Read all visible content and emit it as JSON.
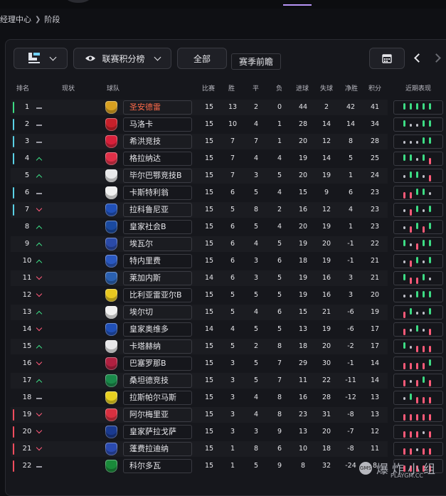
{
  "breadcrumb": {
    "parent": "经理中心",
    "current": "阶段"
  },
  "controls": {
    "league_view": "联赛积分榜",
    "scope": "全部",
    "season_tab": "赛季前瞻"
  },
  "headers": {
    "rank": "排名",
    "trend": "现状",
    "team": "球队",
    "played": "比赛",
    "won": "胜",
    "drawn": "平",
    "lost": "负",
    "gf": "进球",
    "ga": "失球",
    "gd": "净胜",
    "pts": "积分",
    "form": "近期表现"
  },
  "colors": {
    "champions": "#3ddc84",
    "europa": "#5ad1e6",
    "relegation": "#ff4d5e",
    "win": "#3ddc84",
    "draw": "#bfc0c8",
    "loss": "#ff5a78",
    "highlight_team": "#ff6b4a"
  },
  "rows": [
    {
      "pos": "1",
      "trend": "same",
      "team": "圣安德雷",
      "p": "15",
      "w": "13",
      "d": "2",
      "l": "0",
      "gf": "44",
      "ga": "2",
      "gd": "42",
      "pts": "41",
      "zone": "champions",
      "hl": true,
      "form": [
        "w",
        "w",
        "w",
        "w",
        "w"
      ],
      "crest": "#d8a020"
    },
    {
      "pos": "2",
      "trend": "same",
      "team": "马洛卡",
      "p": "15",
      "w": "10",
      "d": "4",
      "l": "1",
      "gf": "28",
      "ga": "14",
      "gd": "14",
      "pts": "34",
      "zone": "europa",
      "form": [
        "w",
        "d",
        "d",
        "w",
        "w"
      ],
      "crest": "#c8202a"
    },
    {
      "pos": "3",
      "trend": "same",
      "team": "希洪竞技",
      "p": "15",
      "w": "7",
      "d": "7",
      "l": "1",
      "gf": "20",
      "ga": "12",
      "gd": "8",
      "pts": "28",
      "zone": "europa",
      "form": [
        "d",
        "d",
        "d",
        "w",
        "w"
      ],
      "crest": "#d8203a"
    },
    {
      "pos": "4",
      "trend": "up",
      "team": "格拉纳达",
      "p": "15",
      "w": "7",
      "d": "4",
      "l": "4",
      "gf": "19",
      "ga": "14",
      "gd": "5",
      "pts": "25",
      "zone": "europa",
      "form": [
        "w",
        "w",
        "d",
        "w",
        "l"
      ],
      "crest": "#e03048"
    },
    {
      "pos": "5",
      "trend": "up",
      "team": "毕尔巴鄂竞技B",
      "p": "15",
      "w": "7",
      "d": "3",
      "l": "5",
      "gf": "20",
      "ga": "19",
      "gd": "1",
      "pts": "24",
      "zone": "",
      "form": [
        "d",
        "w",
        "w",
        "d",
        "l"
      ],
      "crest": "#e8e8ea"
    },
    {
      "pos": "6",
      "trend": "same",
      "team": "卡斯特利翁",
      "p": "15",
      "w": "6",
      "d": "5",
      "l": "4",
      "gf": "15",
      "ga": "9",
      "gd": "6",
      "pts": "23",
      "zone": "europa",
      "form": [
        "l",
        "l",
        "w",
        "w",
        "d"
      ],
      "crest": "#f0f0f0"
    },
    {
      "pos": "7",
      "trend": "down",
      "team": "拉科鲁尼亚",
      "p": "15",
      "w": "5",
      "d": "8",
      "l": "2",
      "gf": "16",
      "ga": "12",
      "gd": "4",
      "pts": "23",
      "zone": "europa",
      "form": [
        "d",
        "l",
        "w",
        "d",
        "w"
      ],
      "crest": "#2050b8"
    },
    {
      "pos": "8",
      "trend": "up",
      "team": "皇家社会B",
      "p": "15",
      "w": "6",
      "d": "5",
      "l": "4",
      "gf": "20",
      "ga": "19",
      "gd": "1",
      "pts": "23",
      "zone": "",
      "form": [
        "d",
        "l",
        "w",
        "l",
        "w"
      ],
      "crest": "#1a4aa0"
    },
    {
      "pos": "9",
      "trend": "up",
      "team": "埃瓦尔",
      "p": "15",
      "w": "6",
      "d": "4",
      "l": "5",
      "gf": "19",
      "ga": "20",
      "gd": "-1",
      "pts": "22",
      "zone": "",
      "form": [
        "w",
        "d",
        "l",
        "w",
        "w"
      ],
      "crest": "#2a4aa8"
    },
    {
      "pos": "10",
      "trend": "up",
      "team": "特内里费",
      "p": "15",
      "w": "6",
      "d": "3",
      "l": "6",
      "gf": "18",
      "ga": "19",
      "gd": "-1",
      "pts": "21",
      "zone": "",
      "form": [
        "d",
        "l",
        "w",
        "d",
        "w"
      ],
      "crest": "#2a58c0"
    },
    {
      "pos": "11",
      "trend": "down",
      "team": "莱加内斯",
      "p": "14",
      "w": "6",
      "d": "3",
      "l": "5",
      "gf": "19",
      "ga": "16",
      "gd": "3",
      "pts": "21",
      "zone": "",
      "form": [
        "w",
        "l",
        "l",
        "w",
        "d"
      ],
      "crest": "#2a60b0"
    },
    {
      "pos": "12",
      "trend": "down",
      "team": "比利亚雷亚尔B",
      "p": "15",
      "w": "5",
      "d": "5",
      "l": "5",
      "gf": "19",
      "ga": "16",
      "gd": "3",
      "pts": "20",
      "zone": "",
      "form": [
        "d",
        "d",
        "w",
        "w",
        "w"
      ],
      "crest": "#e8c820"
    },
    {
      "pos": "13",
      "trend": "up",
      "team": "埃尔切",
      "p": "15",
      "w": "5",
      "d": "4",
      "l": "6",
      "gf": "15",
      "ga": "21",
      "gd": "-6",
      "pts": "19",
      "zone": "",
      "form": [
        "l",
        "w",
        "d",
        "d",
        "w"
      ],
      "crest": "#f0f0f0"
    },
    {
      "pos": "14",
      "trend": "down",
      "team": "皇家奥维多",
      "p": "14",
      "w": "4",
      "d": "5",
      "l": "5",
      "gf": "13",
      "ga": "19",
      "gd": "-6",
      "pts": "17",
      "zone": "",
      "form": [
        "l",
        "d",
        "w",
        "d",
        "l"
      ],
      "crest": "#2050b8"
    },
    {
      "pos": "15",
      "trend": "up",
      "team": "卡塔赫纳",
      "p": "15",
      "w": "5",
      "d": "2",
      "l": "8",
      "gf": "18",
      "ga": "20",
      "gd": "-2",
      "pts": "17",
      "zone": "",
      "form": [
        "w",
        "d",
        "l",
        "l",
        "l"
      ],
      "crest": "#e8e8ea"
    },
    {
      "pos": "16",
      "trend": "down",
      "team": "巴塞罗那B",
      "p": "15",
      "w": "3",
      "d": "5",
      "l": "7",
      "gf": "29",
      "ga": "30",
      "gd": "-1",
      "pts": "14",
      "zone": "",
      "form": [
        "l",
        "l",
        "l",
        "l",
        "w"
      ],
      "crest": "#b02040"
    },
    {
      "pos": "17",
      "trend": "up",
      "team": "桑坦德竞技",
      "p": "15",
      "w": "3",
      "d": "5",
      "l": "7",
      "gf": "11",
      "ga": "22",
      "gd": "-11",
      "pts": "14",
      "zone": "",
      "form": [
        "l",
        "d",
        "l",
        "w",
        "l"
      ],
      "crest": "#1a8a4a"
    },
    {
      "pos": "18",
      "trend": "same",
      "team": "拉斯帕尔马斯",
      "p": "15",
      "w": "3",
      "d": "4",
      "l": "8",
      "gf": "16",
      "ga": "28",
      "gd": "-12",
      "pts": "13",
      "zone": "",
      "form": [
        "d",
        "w",
        "l",
        "l",
        "l"
      ],
      "crest": "#e8d020"
    },
    {
      "pos": "19",
      "trend": "down",
      "team": "阿尔梅里亚",
      "p": "15",
      "w": "3",
      "d": "4",
      "l": "8",
      "gf": "23",
      "ga": "31",
      "gd": "-8",
      "pts": "13",
      "zone": "relegation",
      "form": [
        "l",
        "l",
        "l",
        "l",
        "l"
      ],
      "crest": "#d83040"
    },
    {
      "pos": "20",
      "trend": "down",
      "team": "皇家萨拉戈萨",
      "p": "15",
      "w": "3",
      "d": "3",
      "l": "9",
      "gf": "13",
      "ga": "20",
      "gd": "-7",
      "pts": "12",
      "zone": "relegation",
      "form": [
        "l",
        "l",
        "l",
        "d",
        "l"
      ],
      "crest": "#1a3a90"
    },
    {
      "pos": "21",
      "trend": "down",
      "team": "蓬费拉迪纳",
      "p": "15",
      "w": "1",
      "d": "8",
      "l": "6",
      "gf": "10",
      "ga": "18",
      "gd": "-8",
      "pts": "11",
      "zone": "relegation",
      "form": [
        "l",
        "l",
        "d",
        "l",
        "l"
      ],
      "crest": "#2a4ab0"
    },
    {
      "pos": "22",
      "trend": "same",
      "team": "科尔多瓦",
      "p": "15",
      "w": "1",
      "d": "5",
      "l": "9",
      "gf": "8",
      "ga": "32",
      "gd": "-24",
      "pts": "8",
      "zone": "relegation",
      "form": [
        "l",
        "l",
        "l",
        "l",
        "l"
      ],
      "crest": "#1a8a3a"
    }
  ],
  "watermark": {
    "text": "爆炸小组",
    "url": "PLAYGM.CC",
    "logo": "GMS"
  }
}
